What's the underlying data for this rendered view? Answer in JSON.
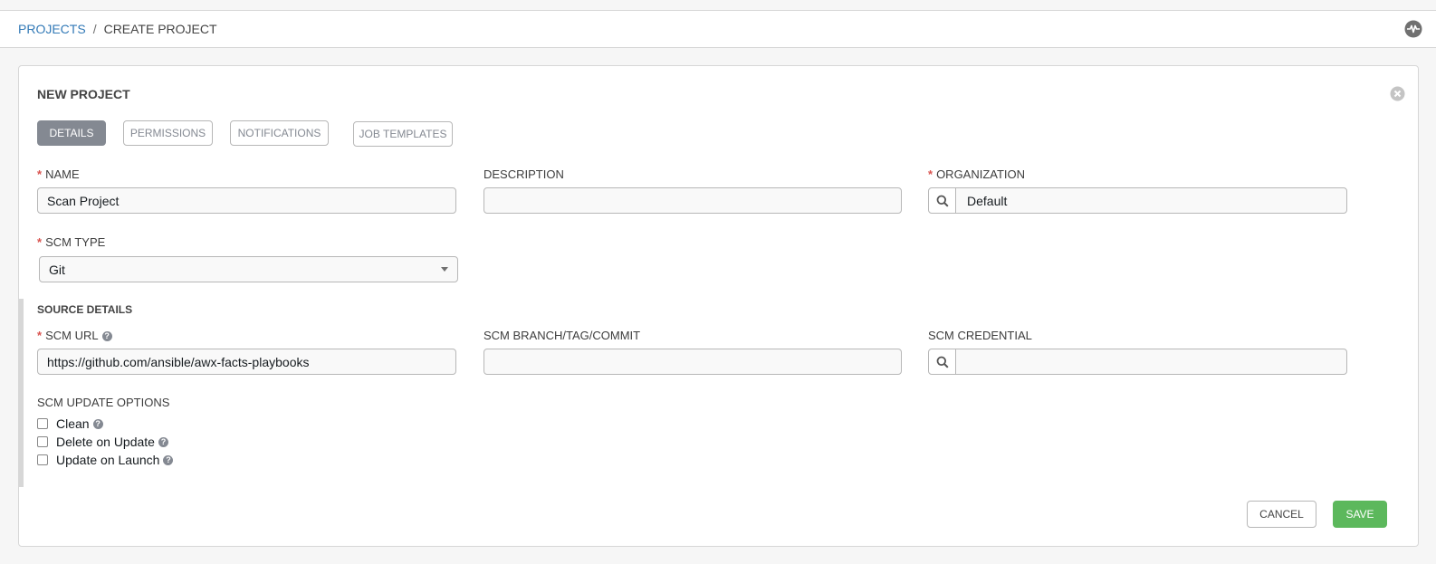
{
  "breadcrumb": {
    "projects": "PROJECTS",
    "separator": "/",
    "current": "CREATE PROJECT"
  },
  "header_icons": {
    "activity": "activity-stream-icon"
  },
  "panel": {
    "title": "NEW PROJECT",
    "close_icon": "close-icon"
  },
  "tabs": [
    {
      "label": "DETAILS",
      "active": true
    },
    {
      "label": "PERMISSIONS",
      "active": false
    },
    {
      "label": "NOTIFICATIONS",
      "active": false
    },
    {
      "label": "JOB TEMPLATES",
      "active": false
    }
  ],
  "form": {
    "name": {
      "label": "NAME",
      "required": "*",
      "value": "Scan Project"
    },
    "description": {
      "label": "DESCRIPTION",
      "value": ""
    },
    "organization": {
      "label": "ORGANIZATION",
      "required": "*",
      "value": "Default"
    },
    "scm_type": {
      "label": "SCM TYPE",
      "required": "*",
      "value": "Git"
    }
  },
  "source_details": {
    "title": "SOURCE DETAILS",
    "scm_url": {
      "label": "SCM URL",
      "required": "*",
      "value": "https://github.com/ansible/awx-facts-playbooks"
    },
    "scm_branch": {
      "label": "SCM BRANCH/TAG/COMMIT",
      "value": ""
    },
    "scm_credential": {
      "label": "SCM CREDENTIAL",
      "value": ""
    },
    "update_options": {
      "label": "SCM UPDATE OPTIONS",
      "clean": "Clean",
      "delete_on_update": "Delete on Update",
      "update_on_launch": "Update on Launch"
    }
  },
  "actions": {
    "cancel": "CANCEL",
    "save": "SAVE"
  },
  "colors": {
    "accent": "#337ab7",
    "save": "#5cb85c",
    "required": "#d9534f",
    "tab_active": "#848992"
  }
}
